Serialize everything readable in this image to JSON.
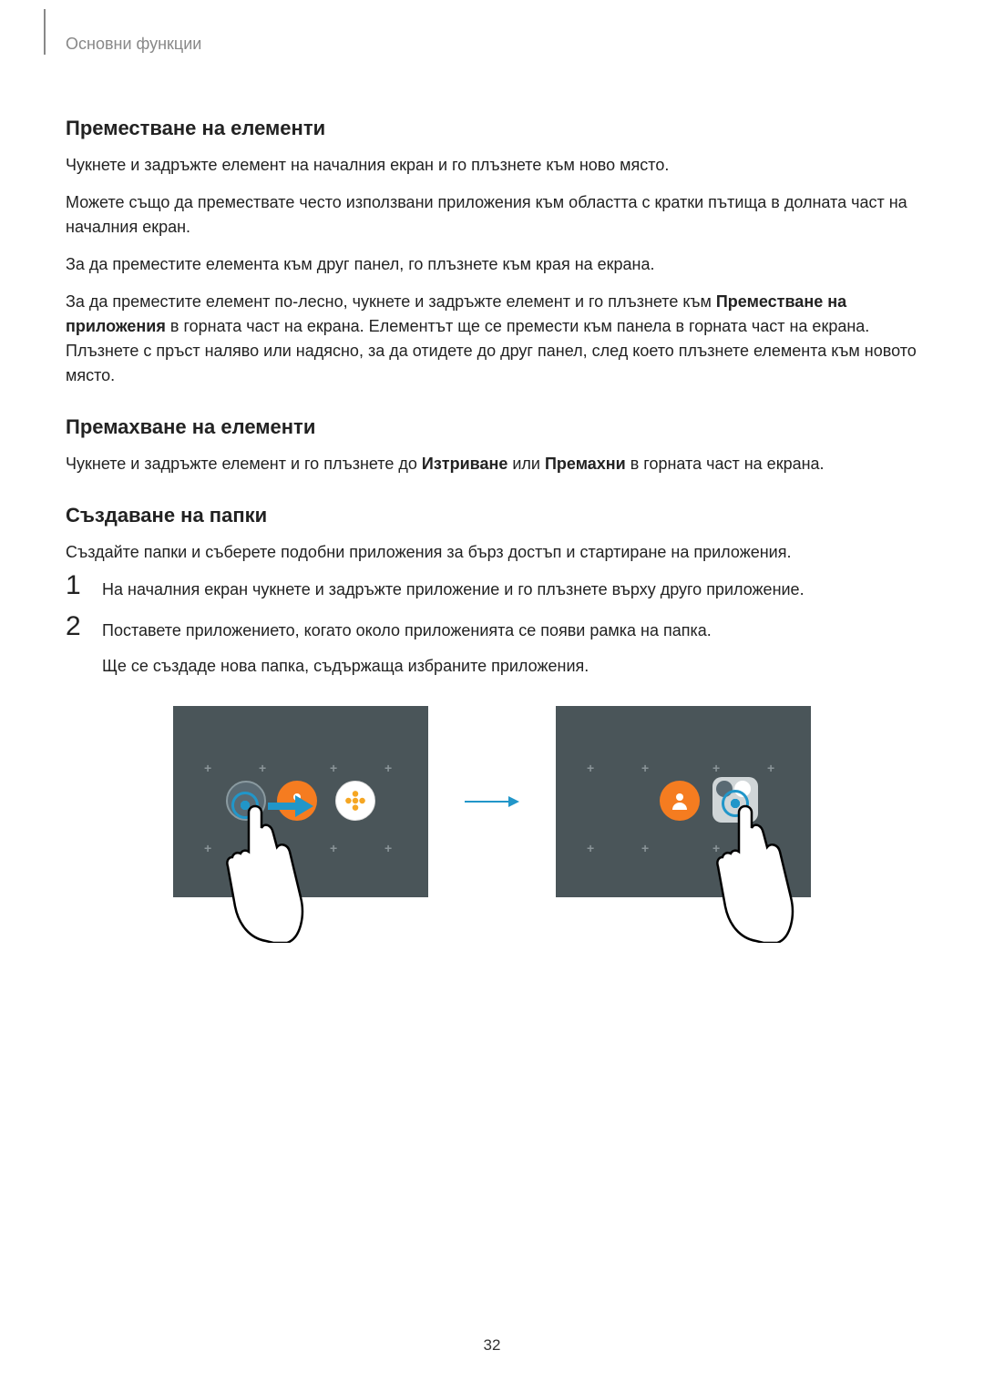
{
  "header": {
    "section_label": "Основни функции"
  },
  "sections": {
    "move": {
      "heading": "Преместване на елементи",
      "p1": "Чукнете и задръжте елемент на началния екран и го плъзнете към ново място.",
      "p2": "Можете също да премествате често използвани приложения към областта с кратки пътища в долната част на началния екран.",
      "p3": "За да преместите елемента към друг панел, го плъзнете към края на екрана.",
      "p4_pre": "За да преместите елемент по-лесно, чукнете и задръжте елемент и го плъзнете към ",
      "p4_bold": "Преместване на приложения",
      "p4_post": " в горната част на екрана. Елементът ще се премести към панела в горната част на екрана. Плъзнете с пръст наляво или надясно, за да отидете до друг панел, след което плъзнете елемента към новото място."
    },
    "remove": {
      "heading": "Премахване на елементи",
      "p1_pre": "Чукнете и задръжте елемент и го плъзнете до ",
      "p1_bold1": "Изтриване",
      "p1_mid": " или ",
      "p1_bold2": "Премахни",
      "p1_post": " в горната част на екрана."
    },
    "folders": {
      "heading": "Създаване на папки",
      "intro": "Създайте папки и съберете подобни приложения за бърз достъп и стартиране на приложения.",
      "step1": "На началния екран чукнете и задръжте приложение и го плъзнете върху друго приложение.",
      "step2": "Поставете приложението, когато около приложенията се появи рамка на папка.",
      "step2_sub": "Ще се създаде нова папка, съдържаща избраните приложения."
    }
  },
  "page_number": "32"
}
